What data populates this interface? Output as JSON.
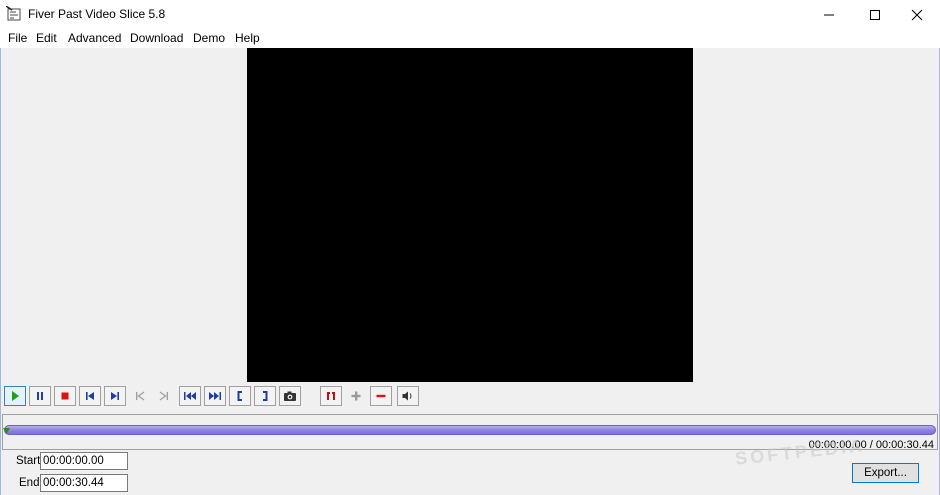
{
  "window": {
    "title": "Fiver Past Video Slice 5.8",
    "minimize_icon": "minimize-icon",
    "maximize_icon": "maximize-icon",
    "close_icon": "close-icon"
  },
  "menu": {
    "items": [
      "File",
      "Edit",
      "Advanced",
      "Download",
      "Demo",
      "Help"
    ]
  },
  "toolbar": {
    "buttons": [
      {
        "icon": "play-icon",
        "color": "#1aa31a"
      },
      {
        "icon": "pause-icon",
        "color": "#1d3ea6"
      },
      {
        "icon": "stop-icon",
        "color": "#e01010"
      },
      {
        "icon": "skip-to-start-icon",
        "color": "#1d3ea6"
      },
      {
        "icon": "skip-to-end-icon",
        "color": "#1d3ea6"
      },
      {
        "icon": "prev-frame-icon",
        "color": "#a0a0a0"
      },
      {
        "icon": "next-frame-icon",
        "color": "#a0a0a0"
      },
      {
        "icon": "fast-rewind-icon",
        "color": "#1d3ea6"
      },
      {
        "icon": "fast-forward-icon",
        "color": "#1d3ea6"
      },
      {
        "icon": "mark-in-icon",
        "color": "#1d3ea6"
      },
      {
        "icon": "mark-out-icon",
        "color": "#1d3ea6"
      },
      {
        "icon": "camera-icon",
        "color": "#333333"
      },
      {
        "icon": "cut-marker-icon",
        "color": "#c01010"
      },
      {
        "icon": "add-icon",
        "color": "#9a9a9a"
      },
      {
        "icon": "remove-icon",
        "color": "#e01010"
      },
      {
        "icon": "volume-icon",
        "color": "#333333"
      }
    ]
  },
  "seek": {
    "position": 0.0,
    "readout": "00:00:00.00 / 00:00:30.44"
  },
  "range": {
    "start_label": "Start:",
    "start_value": "00:00:00.00",
    "end_label": "End:",
    "end_value": "00:00:30.44"
  },
  "actions": {
    "export_label": "Export..."
  },
  "watermark": "SOFTPEDIA",
  "colors": {
    "accent": "#0078d7",
    "track": "#8f84e6"
  }
}
